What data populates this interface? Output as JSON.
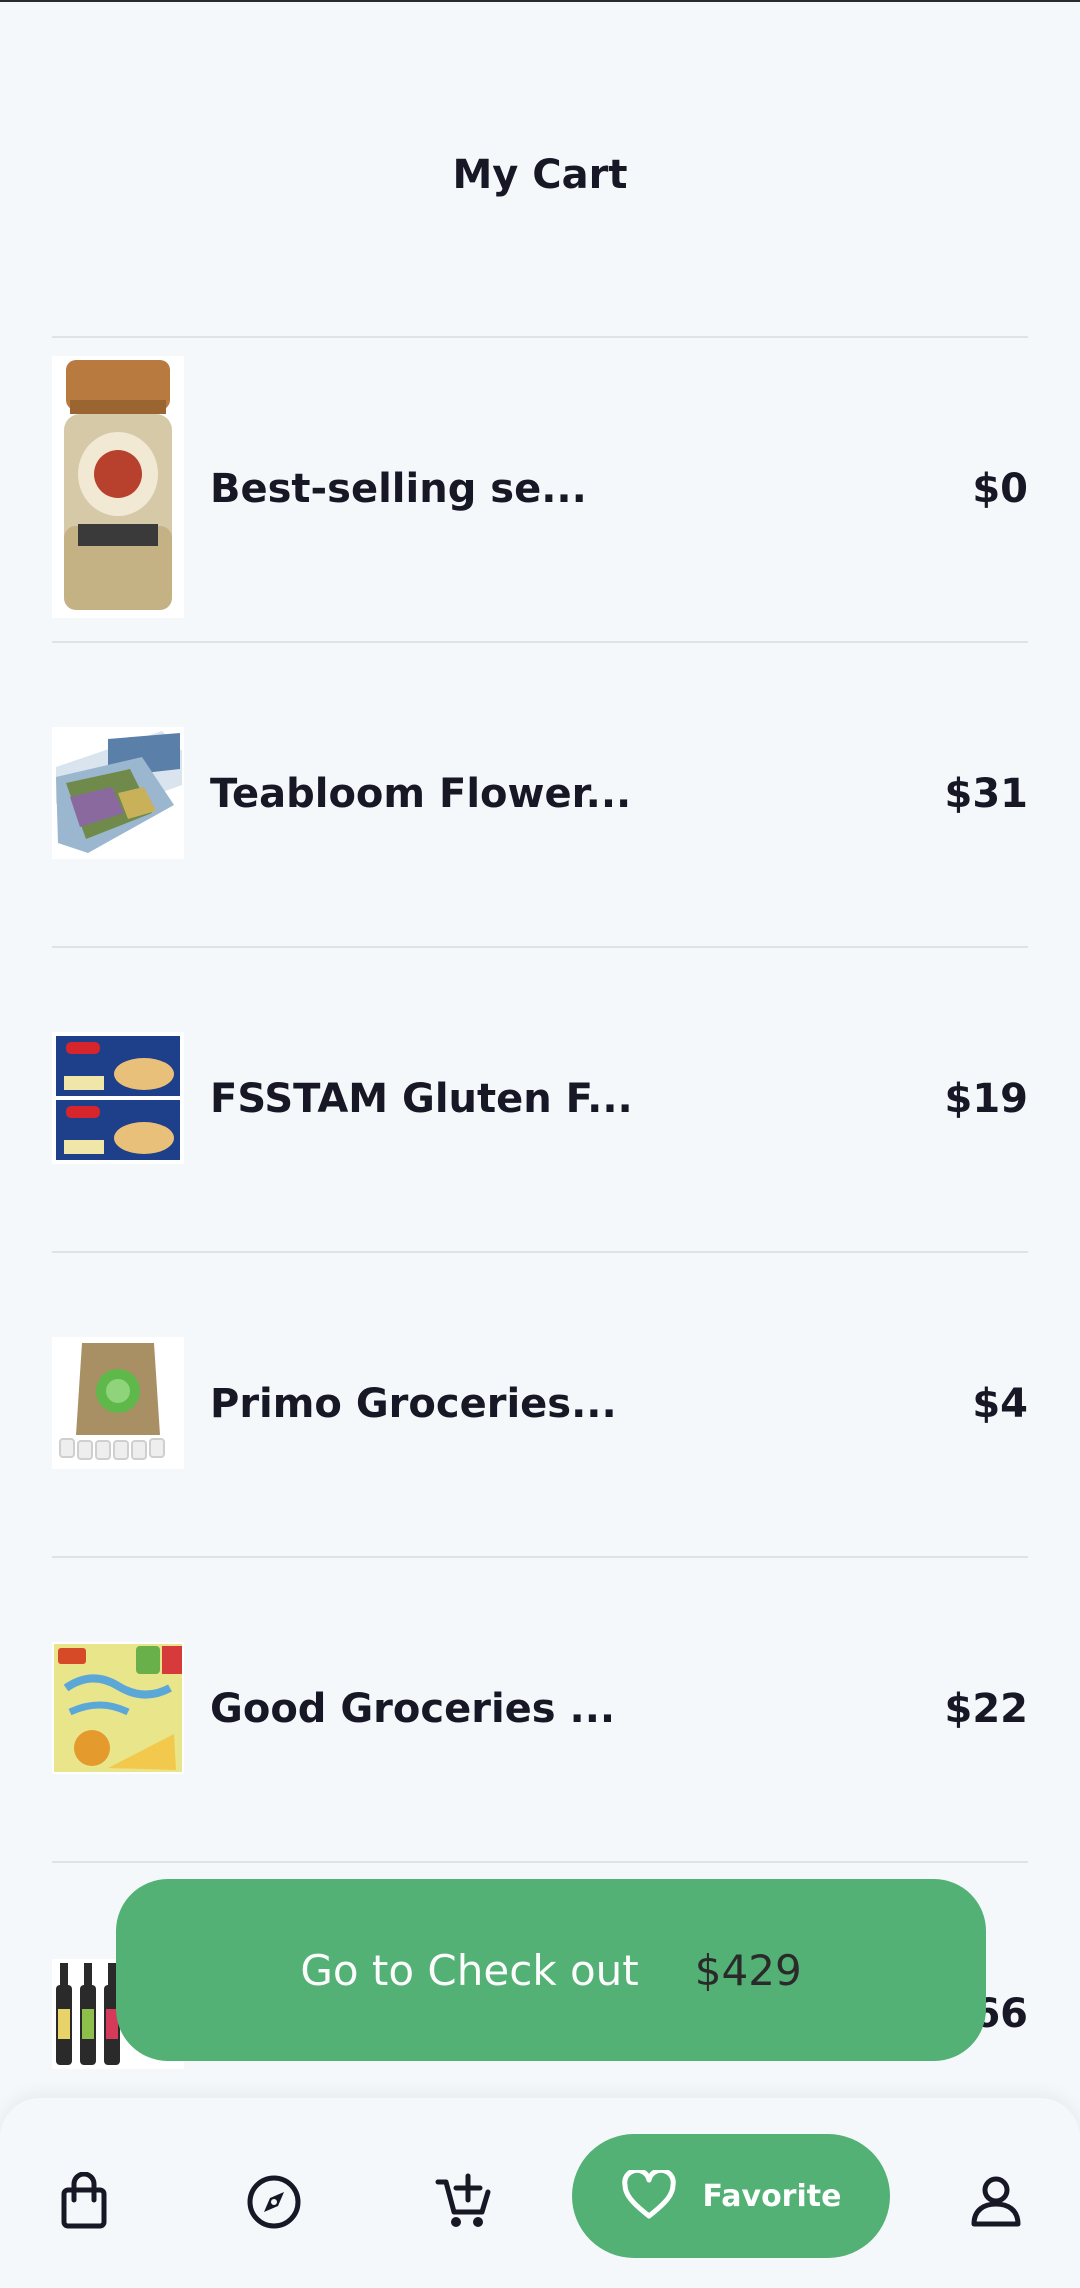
{
  "header": {
    "title": "My Cart"
  },
  "cart": {
    "items": [
      {
        "name": "Best-selling se...",
        "price": "$0"
      },
      {
        "name": "Teabloom Flower...",
        "price": "$31"
      },
      {
        "name": "FSSTAM Gluten F...",
        "price": "$19"
      },
      {
        "name": "Primo Groceries...",
        "price": "$4"
      },
      {
        "name": "Good Groceries ...",
        "price": "$22"
      },
      {
        "name": "",
        "price": "$66"
      }
    ]
  },
  "checkout": {
    "label": "Go to Check out",
    "total": "$429"
  },
  "nav": {
    "items": [
      {
        "icon": "shopping-bag-icon"
      },
      {
        "icon": "compass-icon"
      },
      {
        "icon": "add-to-cart-icon"
      },
      {
        "icon": "heart-icon",
        "label": "Favorite",
        "active": true
      },
      {
        "icon": "user-icon"
      }
    ]
  },
  "colors": {
    "accent": "#53b175",
    "background": "#f4f8fa",
    "text": "#181725",
    "divider": "#e2e2e2"
  }
}
